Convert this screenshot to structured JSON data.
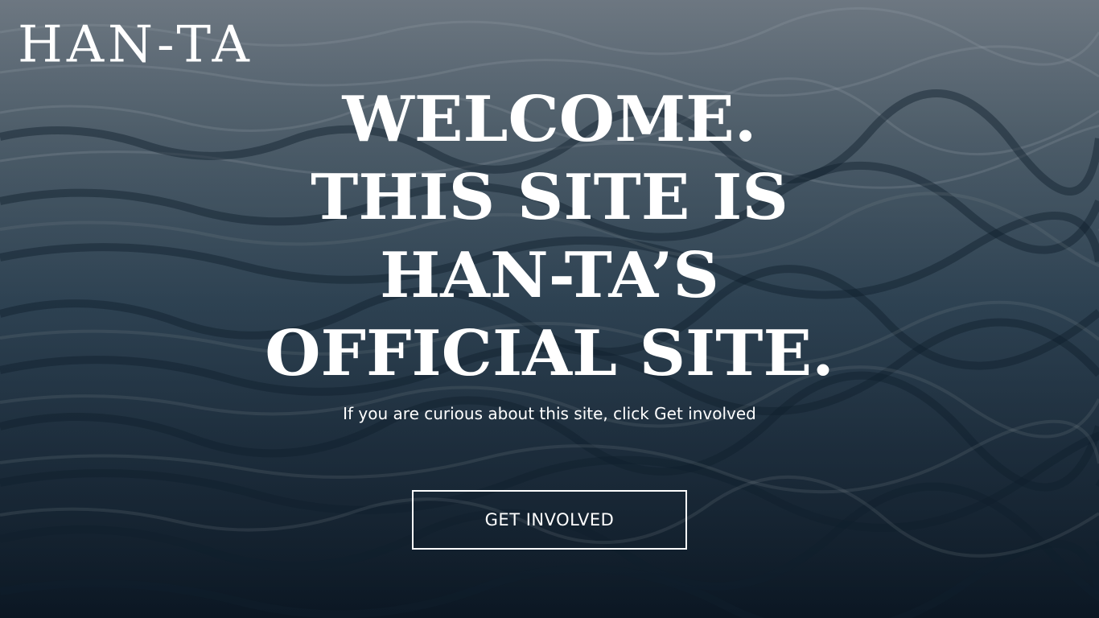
{
  "header": {
    "logo_text": "HAN-TA"
  },
  "hero": {
    "headline_lines": [
      "WELCOME.",
      "THIS SITE IS",
      "HAN-TA’S",
      "OFFICIAL SITE."
    ],
    "subtitle": "If you are curious about this site, click Get involved",
    "cta_label": "GET INVOLVED",
    "background": "ocean-waves-image"
  },
  "colors": {
    "text": "#ffffff",
    "background_top": "#5d6873",
    "background_bottom": "#0c1825"
  }
}
